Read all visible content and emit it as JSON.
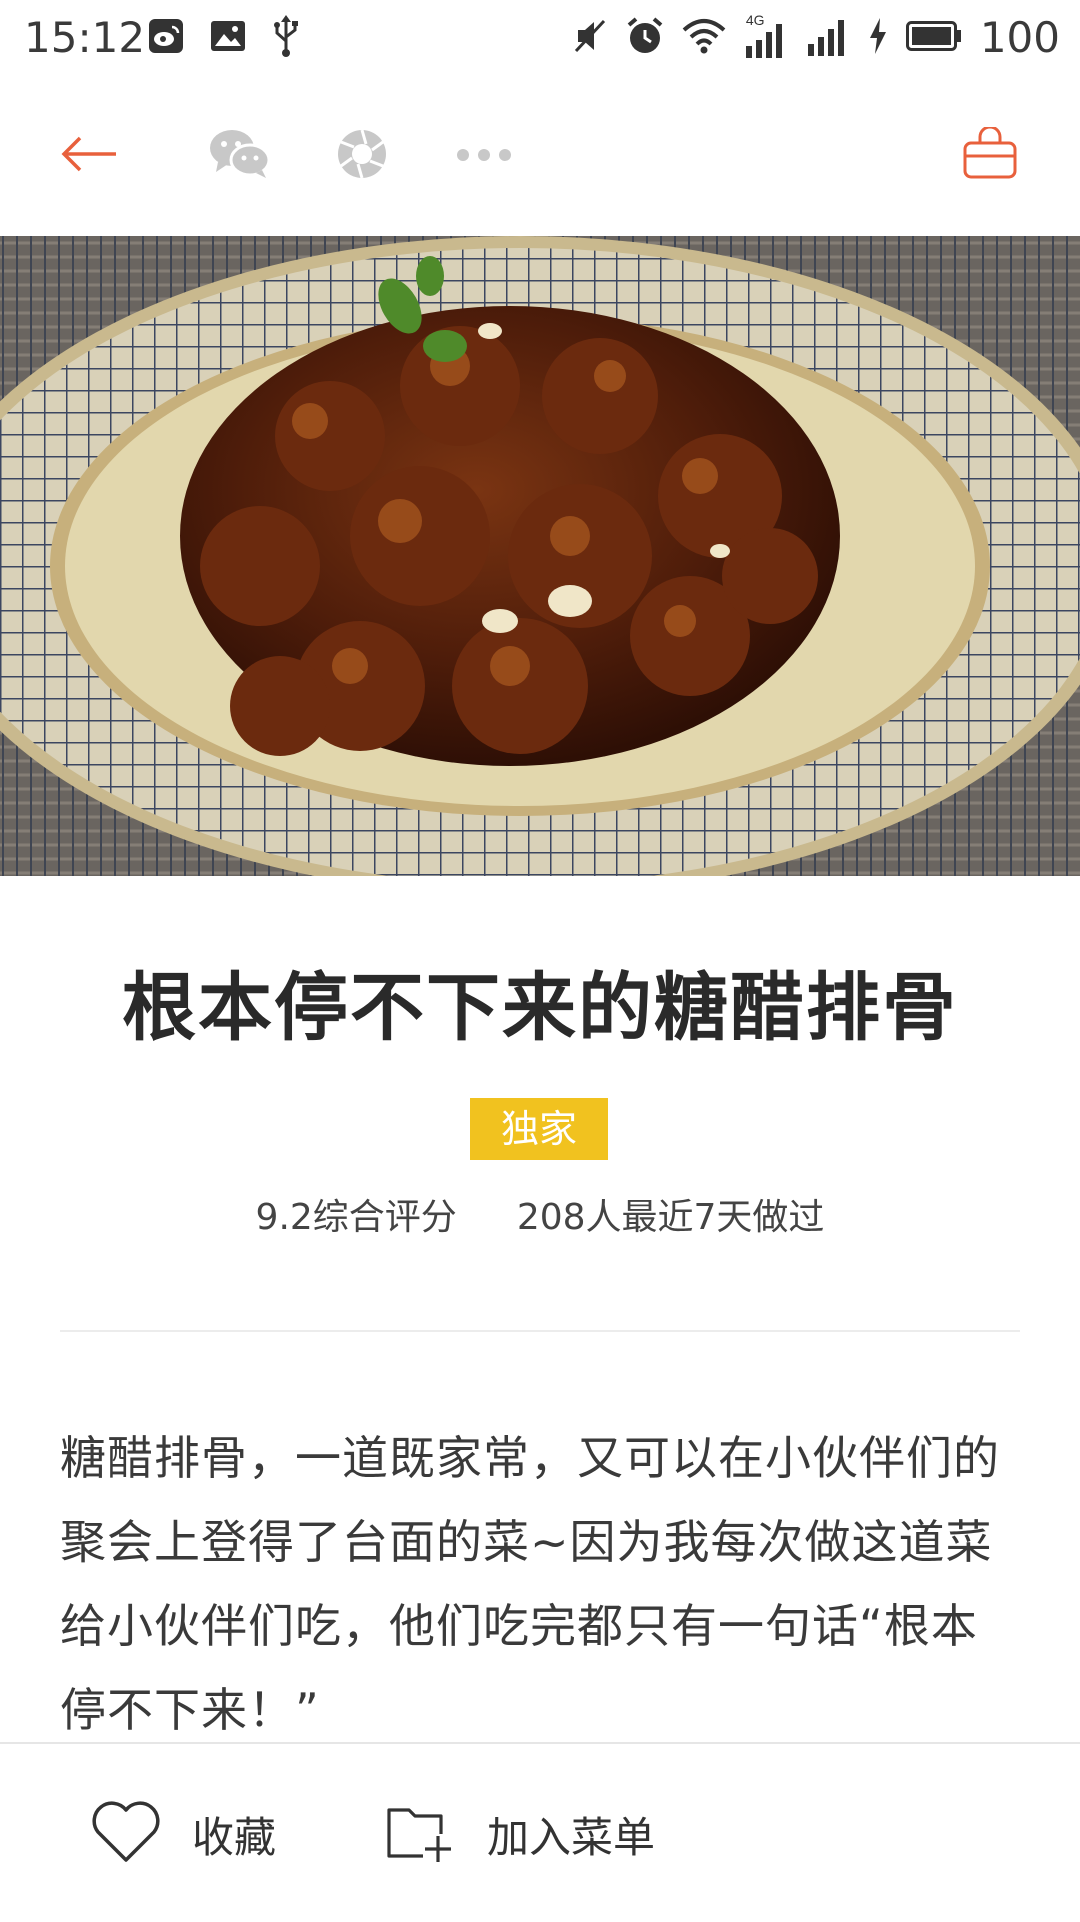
{
  "status_bar": {
    "time": "15:12",
    "left_icons": [
      "weibo-icon",
      "image-icon",
      "usb-icon"
    ],
    "right_icons": [
      "mute-icon",
      "alarm-icon",
      "wifi-icon",
      "signal-4g-icon",
      "signal-icon",
      "charging-icon",
      "battery-icon"
    ],
    "network_label": "4G",
    "battery_percent": "100"
  },
  "toolbar": {
    "back_icon": "back-arrow-icon",
    "share_wechat_icon": "wechat-icon",
    "share_moments_icon": "moments-icon",
    "more_icon": "more-icon",
    "basket_icon": "shopping-basket-icon",
    "accent_color": "#e8603c"
  },
  "recipe": {
    "title": "根本停不下来的糖醋排骨",
    "badge": "独家",
    "badge_color": "#f1c21f",
    "rating_text": "9.2综合评分",
    "made_text": "208人最近7天做过",
    "description": "糖醋排骨，一道既家常，又可以在小伙伴们的聚会上登得了台面的菜~因为我每次做这道菜给小伙伴们吃，他们吃完都只有一句话“根本停不下来！”"
  },
  "bottom_bar": {
    "favorite_label": "收藏",
    "favorite_icon": "heart-icon",
    "add_menu_label": "加入菜单",
    "add_menu_icon": "folder-add-icon"
  }
}
